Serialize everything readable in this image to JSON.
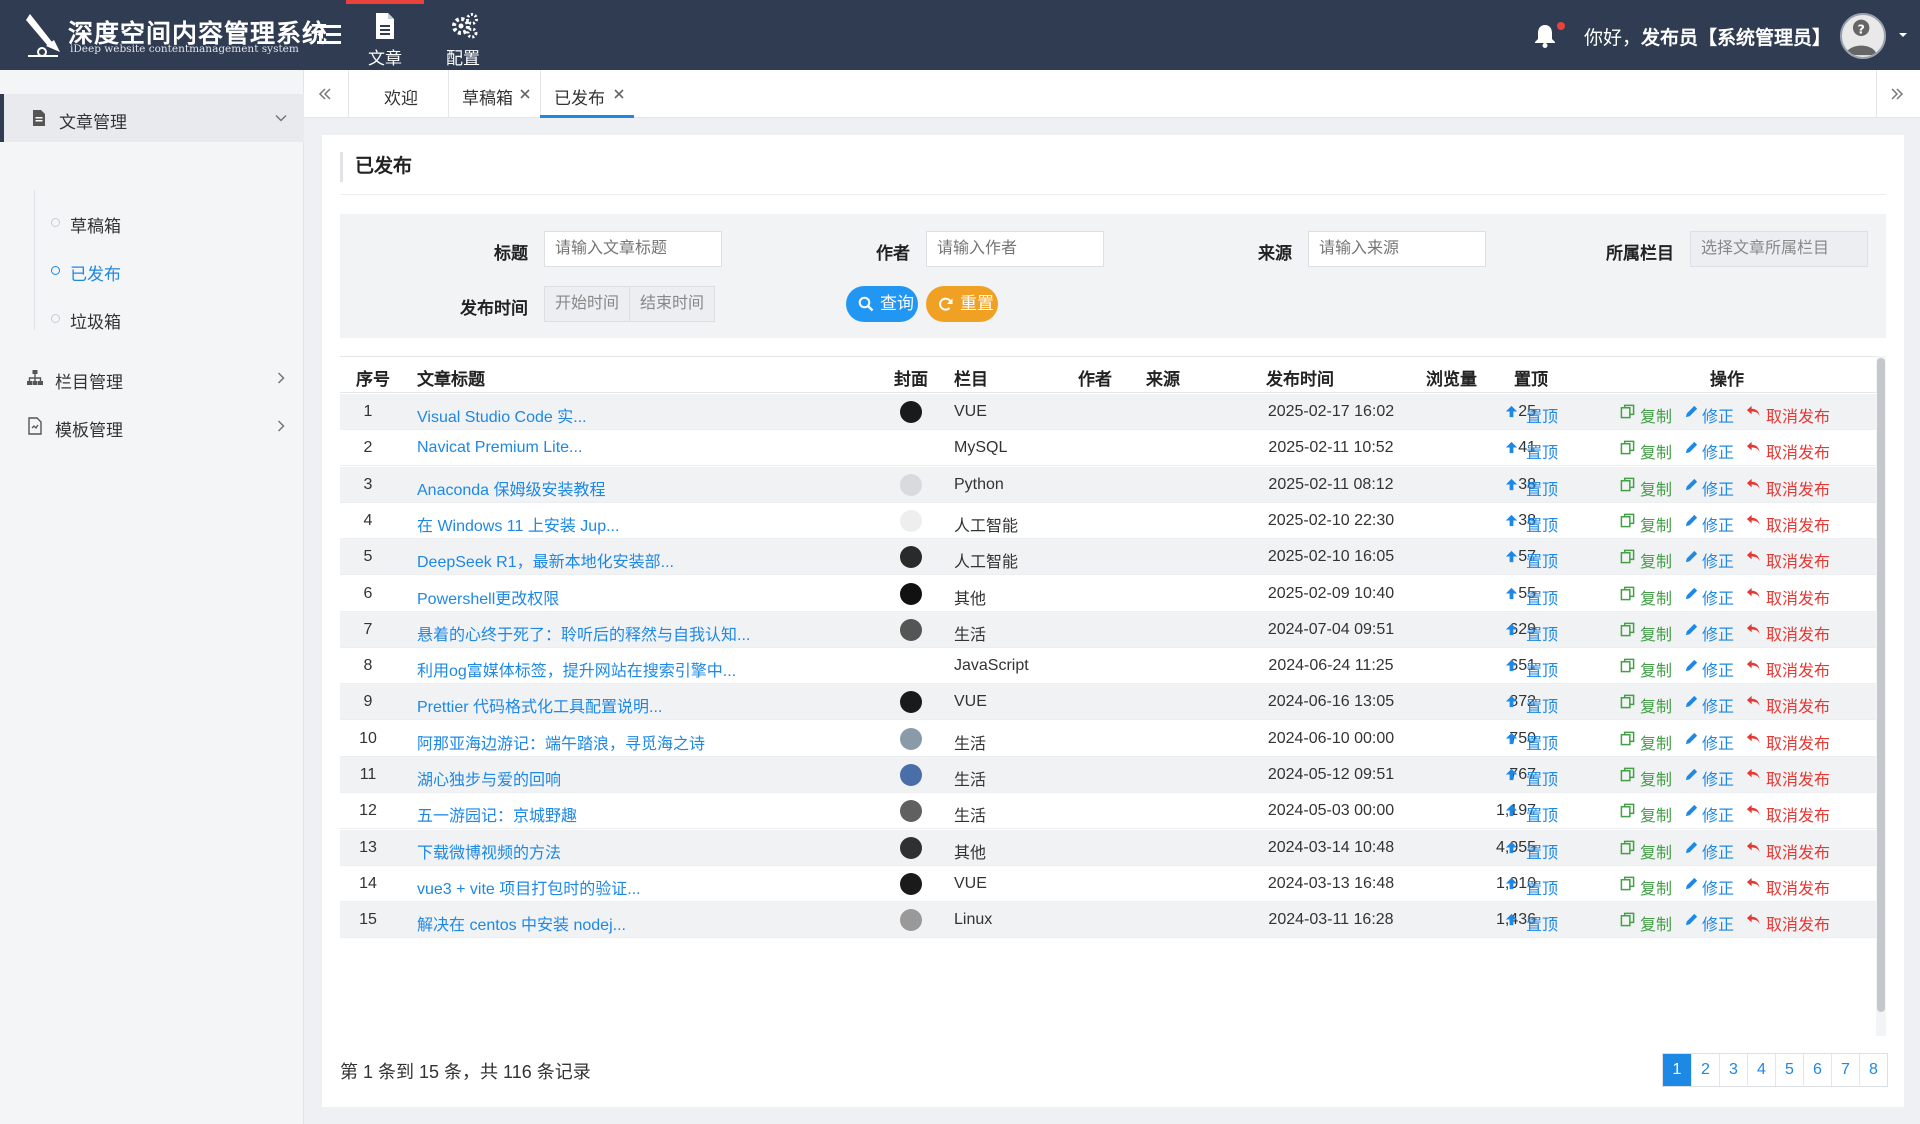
{
  "header": {
    "title": "深度空间内容管理系统",
    "subtitle": "iDeep website contentmanagement system",
    "nav": [
      {
        "label": "文章",
        "icon": "document-icon",
        "active": true
      },
      {
        "label": "配置",
        "icon": "gears-icon",
        "active": false
      }
    ],
    "greeting_prefix": "你好，",
    "greeting_user": "发布员【系统管理员】",
    "accent_color": "#e8423b"
  },
  "sidebar": {
    "groups": [
      {
        "label": "文章管理",
        "icon": "file-icon",
        "open": true,
        "items": [
          {
            "label": "草稿箱",
            "active": false
          },
          {
            "label": "已发布",
            "active": true
          },
          {
            "label": "垃圾箱",
            "active": false
          }
        ]
      },
      {
        "label": "栏目管理",
        "icon": "sitemap-icon",
        "open": false
      },
      {
        "label": "模板管理",
        "icon": "template-icon",
        "open": false
      }
    ]
  },
  "tabs": [
    {
      "label": "欢迎",
      "closable": false,
      "active": false
    },
    {
      "label": "草稿箱",
      "closable": true,
      "active": false
    },
    {
      "label": "已发布",
      "closable": true,
      "active": true
    }
  ],
  "page": {
    "title": "已发布"
  },
  "search": {
    "title_label": "标题",
    "title_placeholder": "请输入文章标题",
    "author_label": "作者",
    "author_placeholder": "请输入作者",
    "source_label": "来源",
    "source_placeholder": "请输入来源",
    "column_label": "所属栏目",
    "column_placeholder": "选择文章所属栏目",
    "time_label": "发布时间",
    "start_placeholder": "开始时间",
    "end_placeholder": "结束时间",
    "query_label": "查询",
    "reset_label": "重置"
  },
  "table": {
    "headers": {
      "no": "序号",
      "title": "文章标题",
      "cover": "封面",
      "column": "栏目",
      "author": "作者",
      "source": "来源",
      "time": "发布时间",
      "views": "浏览量",
      "top": "置顶",
      "ops": "操作"
    },
    "action_labels": {
      "top": "置顶",
      "copy": "复制",
      "edit": "修正",
      "cancel": "取消发布"
    },
    "rows": [
      {
        "no": "1",
        "title": "Visual Studio Code 实...",
        "column": "VUE",
        "time": "2025-02-17 16:02",
        "views": "25",
        "cover": "#1a1a1a"
      },
      {
        "no": "2",
        "title": "Navicat Premium Lite...",
        "column": "MySQL",
        "time": "2025-02-11 10:52",
        "views": "41",
        "cover": ""
      },
      {
        "no": "3",
        "title": "Anaconda 保姆级安装教程",
        "column": "Python",
        "time": "2025-02-11 08:12",
        "views": "38",
        "cover": "#d8dadd"
      },
      {
        "no": "4",
        "title": "在 Windows 11 上安装 Jup...",
        "column": "人工智能",
        "time": "2025-02-10 22:30",
        "views": "38",
        "cover": "#eeeeee"
      },
      {
        "no": "5",
        "title": "DeepSeek R1，最新本地化安装部...",
        "column": "人工智能",
        "time": "2025-02-10 16:05",
        "views": "57",
        "cover": "#2a2a2a"
      },
      {
        "no": "6",
        "title": "Powershell更改权限",
        "column": "其他",
        "time": "2025-02-09 10:40",
        "views": "55",
        "cover": "#111111"
      },
      {
        "no": "7",
        "title": "悬着的心终于死了：聆听后的释然与自我认知...",
        "column": "生活",
        "time": "2024-07-04 09:51",
        "views": "629",
        "cover": "#555555"
      },
      {
        "no": "8",
        "title": "利用og富媒体标签，提升网站在搜索引擎中...",
        "column": "JavaScript",
        "time": "2024-06-24 11:25",
        "views": "651",
        "cover": ""
      },
      {
        "no": "9",
        "title": "Prettier 代码格式化工具配置说明...",
        "column": "VUE",
        "time": "2024-06-16 13:05",
        "views": "872",
        "cover": "#1a1a1a"
      },
      {
        "no": "10",
        "title": "阿那亚海边游记：端午踏浪，寻觅海之诗",
        "column": "生活",
        "time": "2024-06-10 00:00",
        "views": "750",
        "cover": "#8a9aa8"
      },
      {
        "no": "11",
        "title": "湖心独步与爱的回响",
        "column": "生活",
        "time": "2024-05-12 09:51",
        "views": "767",
        "cover": "#4a6ea8"
      },
      {
        "no": "12",
        "title": "五一游园记：京城野趣",
        "column": "生活",
        "time": "2024-05-03 00:00",
        "views": "1,197",
        "cover": "#606060"
      },
      {
        "no": "13",
        "title": "下载微博视频的方法",
        "column": "其他",
        "time": "2024-03-14 10:48",
        "views": "4,055",
        "cover": "#303030"
      },
      {
        "no": "14",
        "title": "vue3 + vite 项目打包时的验证...",
        "column": "VUE",
        "time": "2024-03-13 16:48",
        "views": "1,010",
        "cover": "#1a1a1a"
      },
      {
        "no": "15",
        "title": "解决在 centos 中安装 nodej...",
        "column": "Linux",
        "time": "2024-03-11 16:28",
        "views": "1,436",
        "cover": "#999999"
      }
    ]
  },
  "footer": {
    "summary": "第 1 条到 15 条，共 116 条记录",
    "pages": [
      "1",
      "2",
      "3",
      "4",
      "5",
      "6",
      "7",
      "8"
    ],
    "current_page": "1"
  }
}
